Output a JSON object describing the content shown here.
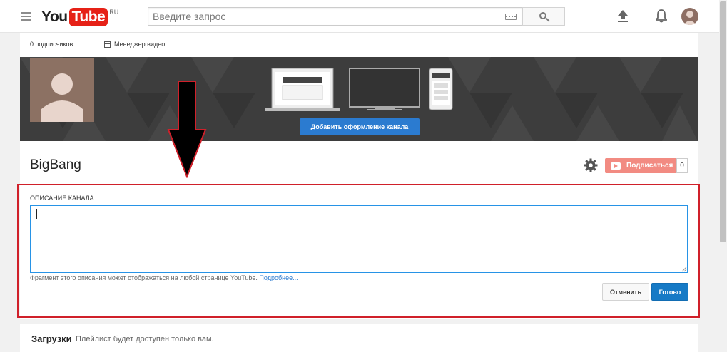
{
  "header": {
    "logo_you": "You",
    "logo_tube": "Tube",
    "logo_region": "RU",
    "search_placeholder": "Введите запрос"
  },
  "channel": {
    "subscribers": "0 подписчиков",
    "video_manager": "Менеджер видео",
    "add_art_button": "Добавить оформление канала",
    "name": "BigBang",
    "subscribe_label": "Подписаться",
    "subscribe_count": "0"
  },
  "description": {
    "label": "ОПИСАНИЕ КАНАЛА",
    "value": "",
    "hint": "Фрагмент этого описания может отображаться на любой странице YouTube.",
    "hint_link": "Подробнее...",
    "cancel": "Отменить",
    "done": "Готово"
  },
  "uploads": {
    "title": "Загрузки",
    "note": "Плейлист будет доступен только вам."
  },
  "colors": {
    "brand_red": "#e62117",
    "accent_blue": "#167ac6",
    "annotation_red": "#d0202a"
  },
  "icons": [
    "menu-icon",
    "keyboard-icon",
    "search-icon",
    "upload-icon",
    "bell-icon",
    "gear-icon",
    "play-icon",
    "film-icon"
  ]
}
